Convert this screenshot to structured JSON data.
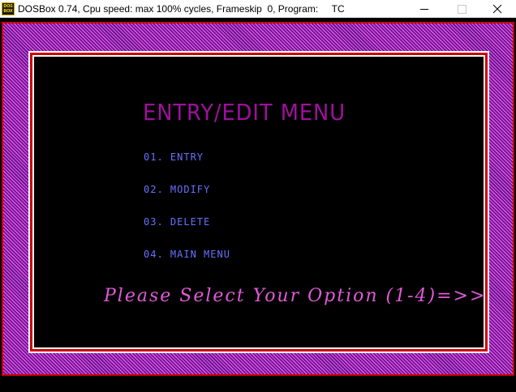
{
  "window": {
    "title": "DOSBox 0.74, Cpu speed: max 100% cycles, Frameskip  0, Program:     TC",
    "icon_line1": "DOS",
    "icon_line2": "BOX"
  },
  "controls": {
    "minimize_icon": "minimize-icon",
    "maximize_icon": "maximize-icon",
    "close_icon": "close-icon"
  },
  "screen": {
    "title": "ENTRY/EDIT MENU",
    "items": [
      {
        "label": "01. ENTRY"
      },
      {
        "label": "02. MODIFY"
      },
      {
        "label": "03. DELETE"
      },
      {
        "label": "04. MAIN MENU"
      }
    ],
    "prompt": "Please Select Your Option (1-4)=>>"
  },
  "colors": {
    "title": "#a0109e",
    "menu_items": "#6870ff",
    "prompt": "#e05ad8",
    "frame_red": "#cc0000",
    "hatch_pink": "#ff4df2",
    "hatch_purple": "#5a1c8a",
    "background": "#000000"
  }
}
